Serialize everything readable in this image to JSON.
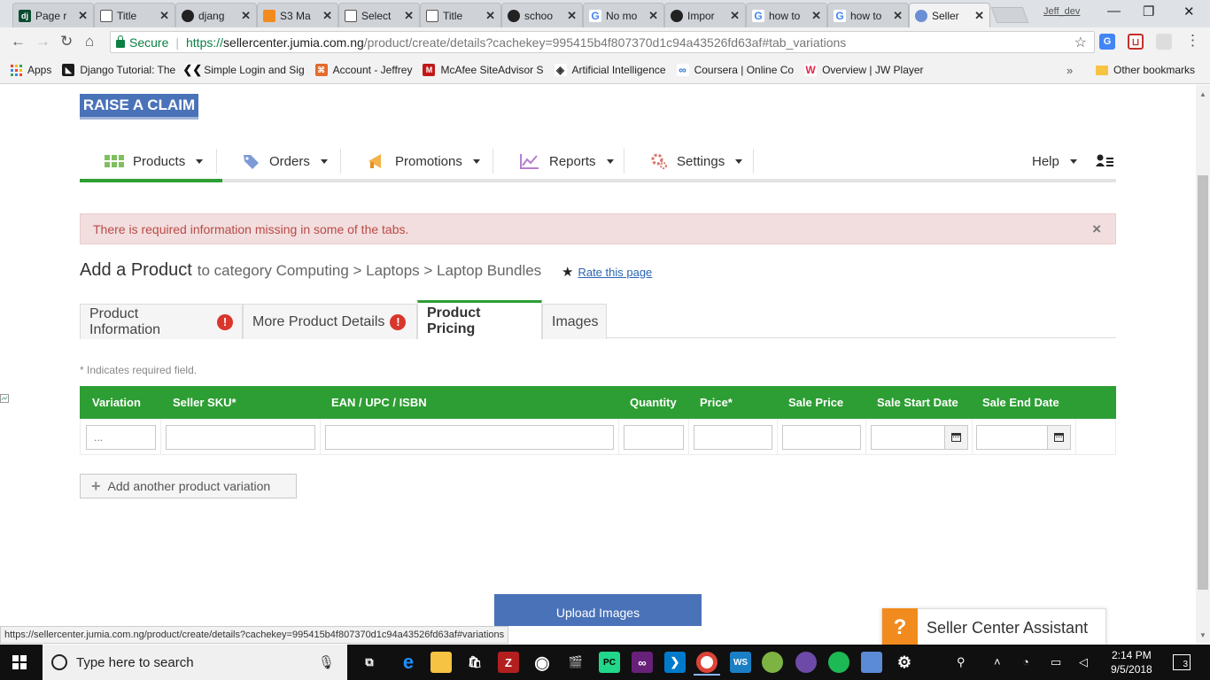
{
  "browser": {
    "tabs": [
      {
        "title": "Page r",
        "icon": "django-icon",
        "color": "#0c4b33"
      },
      {
        "title": "Title",
        "icon": "page-icon",
        "color": ""
      },
      {
        "title": "djang",
        "icon": "github-icon",
        "color": "#222222"
      },
      {
        "title": "S3 Ma",
        "icon": "aws-icon",
        "color": "#f28b1d"
      },
      {
        "title": "Select",
        "icon": "page-icon",
        "color": ""
      },
      {
        "title": "Title",
        "icon": "page-icon",
        "color": ""
      },
      {
        "title": "schoo",
        "icon": "github-icon",
        "color": "#222222"
      },
      {
        "title": "No mo",
        "icon": "google-icon",
        "color": "#4285f4"
      },
      {
        "title": "Impor",
        "icon": "github-icon",
        "color": "#222222"
      },
      {
        "title": "how to",
        "icon": "google-icon",
        "color": "#4285f4"
      },
      {
        "title": "how to",
        "icon": "google-icon",
        "color": "#4285f4"
      },
      {
        "title": "Seller",
        "icon": "jumia-icon",
        "color": "#6a8fd6",
        "active": true
      }
    ],
    "profile_name": "Jeff_dev",
    "secure_label": "Secure",
    "url_scheme": "https://",
    "url_host": "sellercenter.jumia.com.ng",
    "url_rest": "/product/create/details?cachekey=995415b4f807370d1c94a43526fd63af#tab_variations",
    "bookmarks": [
      {
        "label": "Apps",
        "icon": "apps-grid-icon"
      },
      {
        "label": "Django Tutorial: The",
        "icon": "mdn-icon"
      },
      {
        "label": "Simple Login and Sig",
        "icon": "codepen-icon"
      },
      {
        "label": "Account - Jeffrey",
        "icon": "account-icon"
      },
      {
        "label": "McAfee SiteAdvisor S",
        "icon": "mcafee-icon"
      },
      {
        "label": "Artificial Intelligence",
        "icon": "ai-icon"
      },
      {
        "label": "Coursera | Online Co",
        "icon": "coursera-icon"
      },
      {
        "label": "Overview | JW Player",
        "icon": "jwplayer-icon"
      }
    ],
    "bookmarks_more": "»",
    "other_bookmarks": "Other bookmarks",
    "status_url": "https://sellercenter.jumia.com.ng/product/create/details?cachekey=995415b4f807370d1c94a43526fd63af#variations"
  },
  "page": {
    "raise_claim": "RAISE A CLAIM",
    "nav": [
      {
        "label": "Products",
        "icon": "grid-icon",
        "active": true
      },
      {
        "label": "Orders",
        "icon": "tag-icon"
      },
      {
        "label": "Promotions",
        "icon": "megaphone-icon"
      },
      {
        "label": "Reports",
        "icon": "chart-icon"
      },
      {
        "label": "Settings",
        "icon": "gear-icon"
      }
    ],
    "help_label": "Help",
    "alert_text": "There is required information missing in some of the tabs.",
    "alert_close": "×",
    "heading": "Add a Product",
    "heading_sub": "to category Computing > Laptops > Laptop Bundles",
    "rate_link": "Rate this page",
    "tabs": [
      {
        "label": "Product Information",
        "warning": true
      },
      {
        "label": "More Product Details",
        "warning": true
      },
      {
        "label": "Product Pricing",
        "active": true
      },
      {
        "label": "Images"
      }
    ],
    "warning_glyph": "!",
    "required_note": "* Indicates required field.",
    "table_headers": [
      "Variation",
      "Seller SKU*",
      "EAN / UPC / ISBN",
      "Quantity",
      "Price*",
      "Sale Price",
      "Sale Start Date",
      "Sale End Date"
    ],
    "variation_value": "...",
    "add_variation": "Add another product variation",
    "upload_images": "Upload Images",
    "assistant_icon": "?",
    "assistant_label": "Seller Center Assistant",
    "accent_color": "#2d9e33",
    "brand_blue": "#4a72b8"
  },
  "taskbar": {
    "search_placeholder": "Type here to search",
    "time": "2:14 PM",
    "date": "9/5/2018",
    "notifications": "3"
  }
}
